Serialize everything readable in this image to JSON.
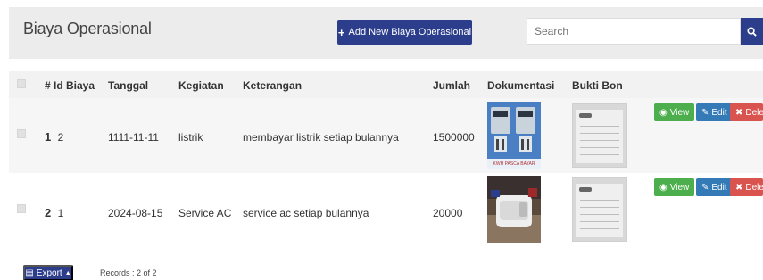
{
  "header": {
    "title": "Biaya Operasional",
    "add_label": "Add New Biaya Operasional",
    "search_placeholder": "Search"
  },
  "table": {
    "columns": [
      "# Id Biaya",
      "Tanggal",
      "Kegiatan",
      "Keterangan",
      "Jumlah",
      "Dokumentasi",
      "Bukti Bon"
    ],
    "rows": [
      {
        "num": "1",
        "id": "2",
        "tanggal": "1111-11-11",
        "kegiatan": "listrik",
        "keterangan": "membayar listrik setiap bulannya",
        "jumlah": "1500000",
        "photo_caption": "KWH PASCA BAYAR"
      },
      {
        "num": "2",
        "id": "1",
        "tanggal": "2024-08-15",
        "kegiatan": "Service AC",
        "keterangan": "service ac setiap bulannya",
        "jumlah": "20000"
      }
    ]
  },
  "actions": {
    "view": "View",
    "edit": "Edit",
    "delete": "Delet"
  },
  "footer": {
    "export_label": "Export",
    "records": "Records : 2 of 2"
  },
  "colors": {
    "primary": "#2c3d8c",
    "view": "#4cae4c",
    "edit": "#337ab7",
    "delete": "#d9534f"
  }
}
